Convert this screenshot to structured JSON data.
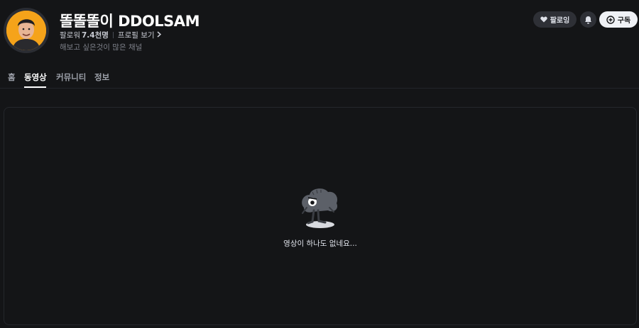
{
  "channel": {
    "name": "똘똘똘이 DDOLSAM",
    "followers_label": "팔로워",
    "followers_count": "7.4천명",
    "profile_link": "프로필 보기",
    "description": "해보고 싶은것이 많은 채널"
  },
  "actions": {
    "follow_label": "팔로잉",
    "subscribe_label": "구독",
    "bell_icon": "bell-icon",
    "heart_icon": "heart-icon",
    "plus_icon": "plus-circle-icon"
  },
  "tabs": [
    {
      "label": "홈",
      "active": false
    },
    {
      "label": "동영상",
      "active": true
    },
    {
      "label": "커뮤니티",
      "active": false
    },
    {
      "label": "정보",
      "active": false
    }
  ],
  "empty_state": {
    "message": "영상이 하나도 없네요...",
    "illustration_icon": "sad-mushroom-character-icon"
  },
  "colors": {
    "background": "#141517",
    "avatar_bg": "#f5a31a",
    "subscribe_bg": "#eff1f5",
    "button_bg": "#2e3036"
  }
}
